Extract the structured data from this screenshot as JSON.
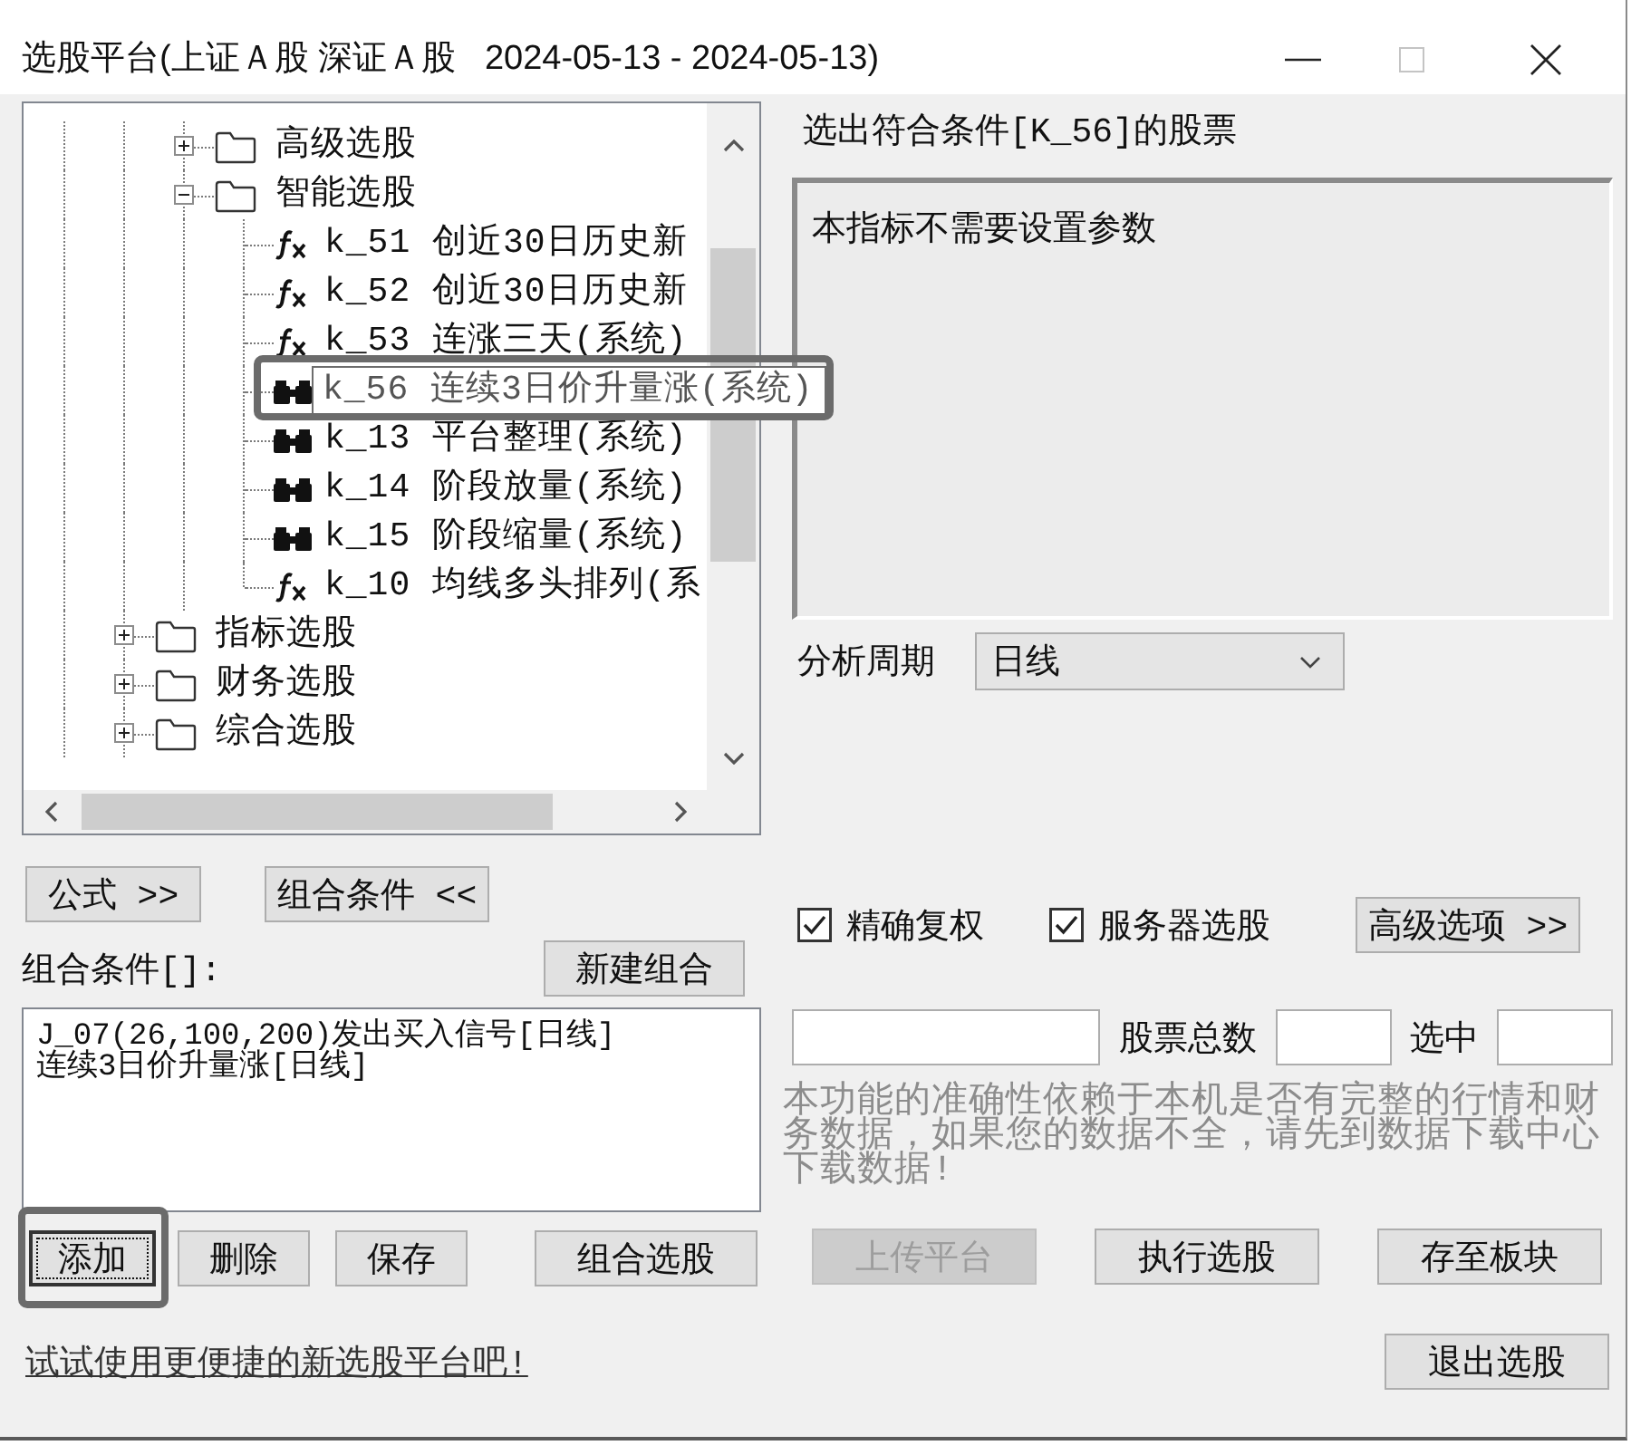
{
  "window": {
    "title": "选股平台(上证Ａ股 深证Ａ股   2024-05-13 - 2024-05-13)",
    "maximize_disabled": true
  },
  "tree": {
    "items": [
      {
        "children": [
          {
            "children": [
              {
                "kind": "folder",
                "label": "高级选股",
                "expanded": false,
                "selected": false,
                "highlighted": false
              },
              {
                "kind": "folder",
                "label": "智能选股",
                "expanded": true,
                "selected": false,
                "highlighted": false,
                "children": [
                  {
                    "kind": "formula",
                    "label": "k_51 创近30日历史新",
                    "selected": false,
                    "highlighted": false
                  },
                  {
                    "kind": "formula",
                    "label": "k_52 创近30日历史新",
                    "selected": false,
                    "highlighted": false
                  },
                  {
                    "kind": "formula",
                    "label": "k_53 连涨三天(系统)",
                    "selected": false,
                    "highlighted": false
                  },
                  {
                    "kind": "binoculars",
                    "label": "k_56 连续3日价升量涨(系统)",
                    "selected": true,
                    "highlighted": true
                  },
                  {
                    "kind": "binoculars",
                    "label": "k_13 平台整理(系统)",
                    "selected": false,
                    "highlighted": false
                  },
                  {
                    "kind": "binoculars",
                    "label": "k_14 阶段放量(系统)",
                    "selected": false,
                    "highlighted": false
                  },
                  {
                    "kind": "binoculars",
                    "label": "k_15 阶段缩量(系统)",
                    "selected": false,
                    "highlighted": false
                  },
                  {
                    "kind": "formula",
                    "label": "k_10 均线多头排列(系",
                    "selected": false,
                    "highlighted": false
                  }
                ]
              }
            ]
          },
          {
            "kind": "folder",
            "label": "指标选股",
            "expanded": false,
            "selected": false,
            "highlighted": false
          },
          {
            "kind": "folder",
            "label": "财务选股",
            "expanded": false,
            "selected": false,
            "highlighted": false
          },
          {
            "kind": "folder",
            "label": "综合选股",
            "expanded": false,
            "selected": false,
            "highlighted": false
          }
        ]
      }
    ]
  },
  "panel_buttons": [
    {
      "label": "公式 >>"
    },
    {
      "label": "组合条件 <<"
    }
  ],
  "combo": {
    "label": "组合条件[]:",
    "new_button": "新建组合",
    "conditions": [
      "J_07(26,100,200)发出买入信号[日线]",
      "连续3日价升量涨[日线]"
    ],
    "buttons": [
      {
        "label": "添加",
        "focused": true,
        "highlighted": true
      },
      {
        "label": "删除",
        "focused": false,
        "highlighted": false
      },
      {
        "label": "保存",
        "focused": false,
        "highlighted": false
      },
      {
        "label": "组合选股",
        "focused": false,
        "highlighted": false
      }
    ]
  },
  "link": "试试使用更便捷的新选股平台吧!",
  "condition_title": "选出符合条件[K_56]的股票",
  "parameters_text": "本指标不需要设置参数",
  "period": {
    "label": "分析周期",
    "value": "日线"
  },
  "options": [
    {
      "label": "精确复权",
      "checked": true
    },
    {
      "label": "服务器选股",
      "checked": true
    }
  ],
  "advanced_button": "高级选项 >>",
  "counts": {
    "total_label": "股票总数",
    "selected_label": "选中"
  },
  "note": "本功能的准确性依赖于本机是否有完整的行情和财务数据，如果您的数据不全，请先到数据下载中心下载数据!",
  "actions": [
    {
      "label": "上传平台",
      "disabled": true
    },
    {
      "label": "执行选股",
      "disabled": false
    },
    {
      "label": "存至板块",
      "disabled": false
    }
  ],
  "exit_button": "退出选股"
}
